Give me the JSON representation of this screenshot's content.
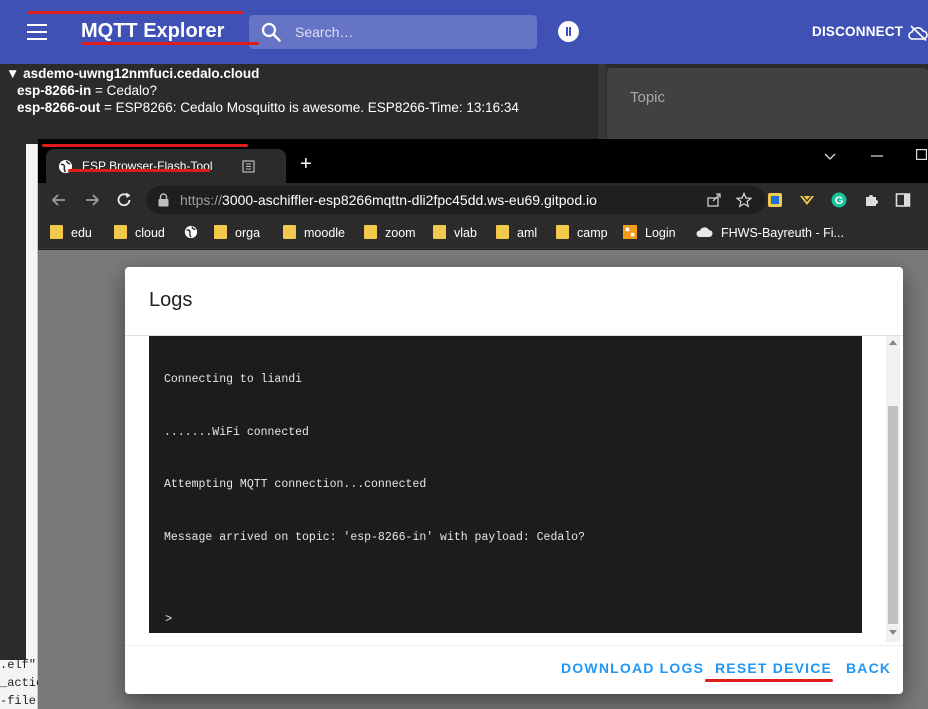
{
  "mqtt": {
    "title": "MQTT Explorer",
    "search_placeholder": "Search…",
    "disconnect_label": "DISCONNECT",
    "tree": {
      "root": "▼ asdemo-uwng12nmfuci.cedalo.cloud",
      "nodes": [
        {
          "key": "esp-8266-in",
          "value": " = Cedalo?"
        },
        {
          "key": "esp-8266-out",
          "value": " = ESP8266: Cedalo Mosquitto is awesome. ESP8266-Time: 13:16:34"
        }
      ]
    },
    "topic_label": "Topic"
  },
  "terminal_fragments": [
    ".elf\"",
    "_actio",
    "-file"
  ],
  "browser": {
    "tab_title": "ESP Browser-Flash-Tool",
    "new_tab": "+",
    "url_host": "https://",
    "url_rest": "3000-aschiffler-esp8266mqttn-dli2fpc45dd.ws-eu69.gitpod.io",
    "bookmarks": [
      {
        "label": "edu",
        "icon": "folder-icon"
      },
      {
        "label": "cloud",
        "icon": "folder-icon"
      },
      {
        "label": "",
        "icon": "globe-icon"
      },
      {
        "label": "orga",
        "icon": "folder-icon"
      },
      {
        "label": "moodle",
        "icon": "folder-icon"
      },
      {
        "label": "zoom",
        "icon": "folder-icon"
      },
      {
        "label": "vlab",
        "icon": "folder-icon"
      },
      {
        "label": "aml",
        "icon": "folder-icon"
      },
      {
        "label": "camp",
        "icon": "folder-icon"
      },
      {
        "label": "Login",
        "icon": "fhws-icon"
      },
      {
        "label": "FHWS-Bayreuth - Fi...",
        "icon": "cloud-icon"
      }
    ]
  },
  "dialog": {
    "title": "Logs",
    "log_lines": [
      "Connecting to liandi",
      ".......WiFi connected",
      "Attempting MQTT connection...connected",
      "Message arrived on topic: 'esp-8266-in' with payload: Cedalo?"
    ],
    "prompt": ">",
    "buttons": {
      "download": "DOWNLOAD LOGS",
      "reset": "RESET DEVICE",
      "back": "BACK"
    }
  },
  "colors": {
    "mqtt_header": "#3f51b5",
    "annotation_red": "#e01b1b",
    "button_blue": "#2196f3",
    "console_bg": "#1c1c1c"
  }
}
